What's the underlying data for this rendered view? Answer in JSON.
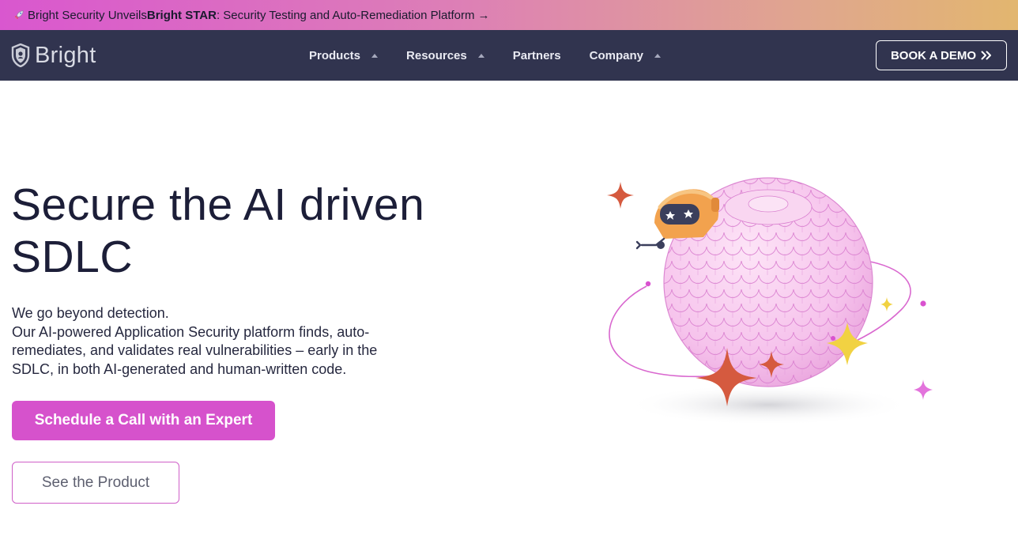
{
  "announcement": {
    "prefix": "Bright Security Unveils ",
    "highlight": "Bright STAR",
    "suffix": ": Security Testing and Auto-Remediation Platform",
    "arrow": "→"
  },
  "nav": {
    "logo_text": "Bright",
    "items": [
      {
        "label": "Products",
        "has_dropdown": true
      },
      {
        "label": "Resources",
        "has_dropdown": true
      },
      {
        "label": "Partners",
        "has_dropdown": false
      },
      {
        "label": "Company",
        "has_dropdown": true
      }
    ],
    "demo_label": "BOOK A DEMO"
  },
  "hero": {
    "title_line1": "Secure the AI driven",
    "title_line2": "SDLC",
    "subtitle_line1": "We go beyond detection.",
    "subtitle_line2": "Our AI-powered Application Security platform finds, auto-remediates, and validates real vulnerabilities – early in the SDLC, in both AI-generated and human-written code.",
    "cta_primary": "Schedule a Call with an Expert",
    "cta_secondary": "See the Product"
  },
  "colors": {
    "nav_bg": "#31344f",
    "accent": "#d652cc",
    "announce_gradient_start": "#d957cf",
    "announce_gradient_end": "#e2b66f"
  },
  "icons": {
    "announcement": "rocket-icon",
    "logo": "shield-logo-icon",
    "demo": "double-chevron-right-icon",
    "dropdown": "caret-up-icon"
  }
}
